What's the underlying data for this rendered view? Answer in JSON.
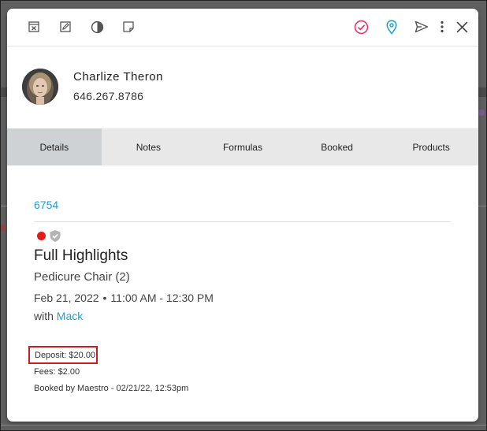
{
  "toolbar": {
    "left_icons": [
      "cancel-appointment-icon",
      "edit-icon",
      "contrast-icon",
      "note-icon"
    ],
    "right_icons": [
      "check-in-icon",
      "location-icon",
      "send-icon",
      "more-vertical-icon",
      "close-icon"
    ],
    "check_color": "#e8336d",
    "location_color": "#1a9fd4"
  },
  "client": {
    "name": "Charlize Theron",
    "phone": "646.267.8786"
  },
  "tabs": [
    "Details",
    "Notes",
    "Formulas",
    "Booked",
    "Products"
  ],
  "active_tab": "Details",
  "appointment": {
    "id": "6754",
    "status_color": "#e31b1b",
    "service": "Full Highlights",
    "resource": "Pedicure Chair (2)",
    "date": "Feb 21, 2022",
    "bullet": "•",
    "time": "11:00 AM - 12:30 PM",
    "with_label": "with",
    "staff": "Mack",
    "deposit": "Deposit: $20.00",
    "fees": "Fees: $2.00",
    "booked_by": "Booked by Maestro - 02/21/22, 12:53pm"
  }
}
